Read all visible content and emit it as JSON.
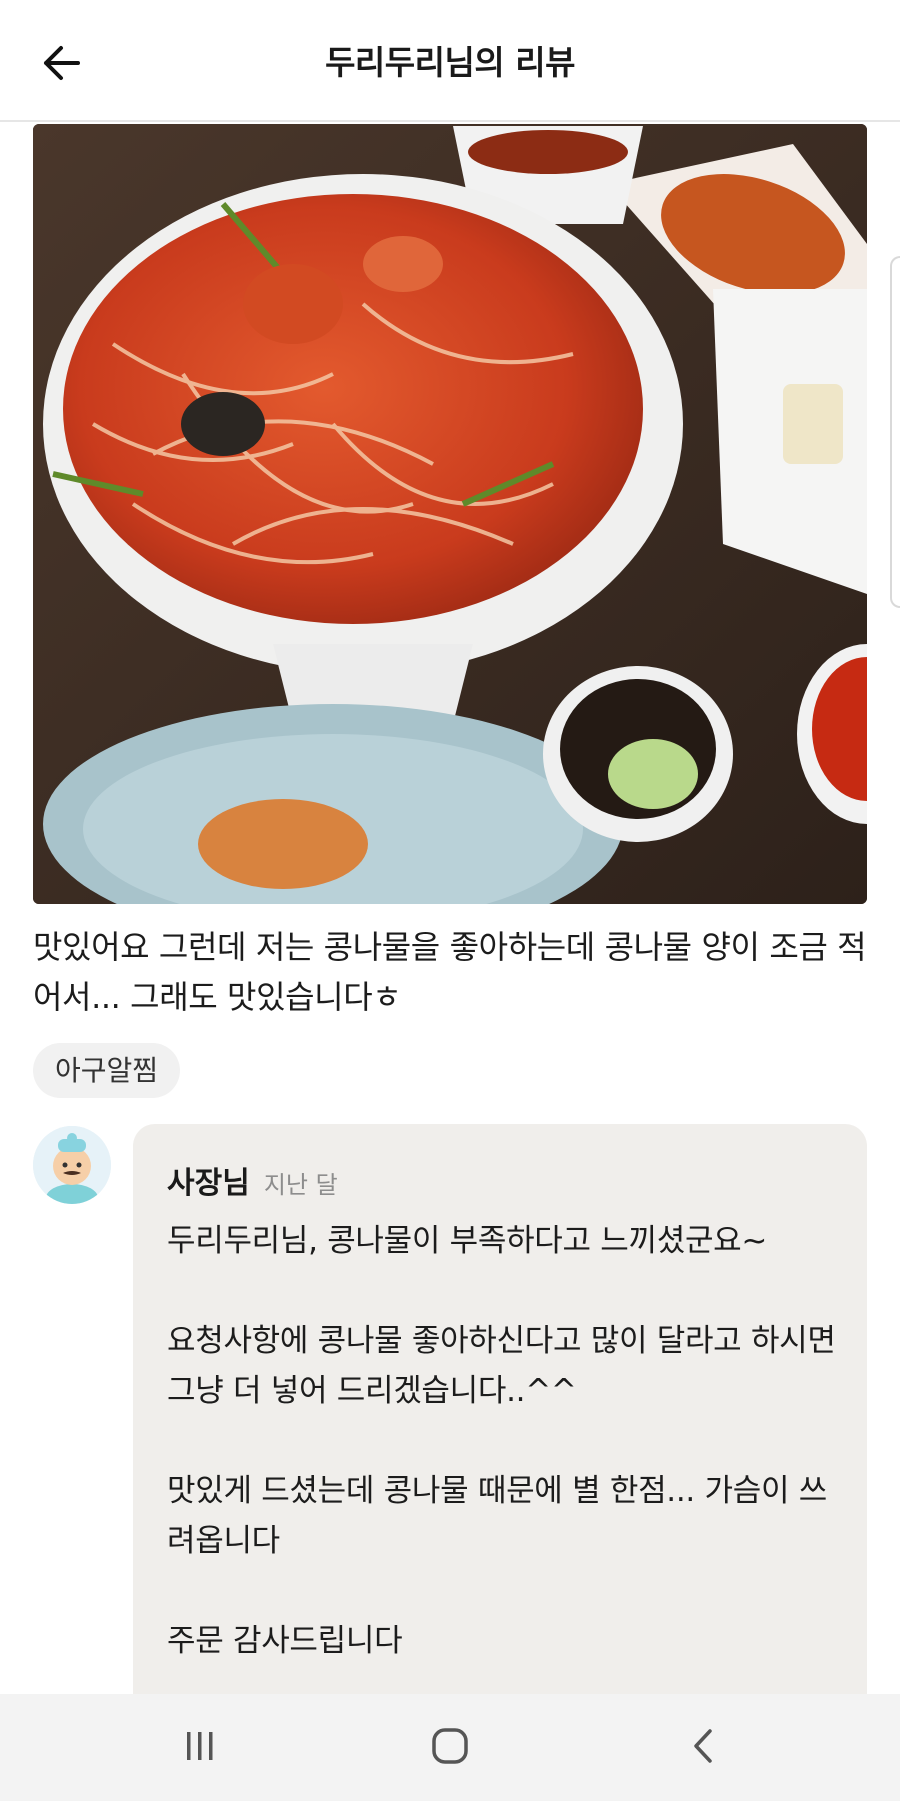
{
  "header": {
    "title": "두리두리님의 리뷰",
    "back_icon": "arrow-left-icon"
  },
  "review": {
    "photo_alt": "review photo",
    "text": "맛있어요 그런데 저는 콩나물을 좋아하는데 콩나물 양이 조금 적어서... 그래도 맛있습니다ㅎ",
    "menu_chip": "아구알찜"
  },
  "reply": {
    "author": "사장님",
    "time": "지난 달",
    "paragraphs": [
      "두리두리님, 콩나물이 부족하다고 느끼셨군요~",
      "요청사항에 콩나물 좋아하신다고 많이 달라고 하시면 그냥 더 넣어 드리겠습니다..^^",
      "맛있게 드셨는데 콩나물 때문에 별 한점... 가슴이 쓰려옵니다",
      "주문 감사드립니다"
    ]
  },
  "navbar": {
    "recent_icon": "recent-apps-icon",
    "home_icon": "home-icon",
    "back_icon": "back-icon"
  },
  "colors": {
    "reply_bg": "#f0eeeb",
    "chip_bg": "#f1f1f1",
    "navbar_bg": "#f3f3f3"
  }
}
